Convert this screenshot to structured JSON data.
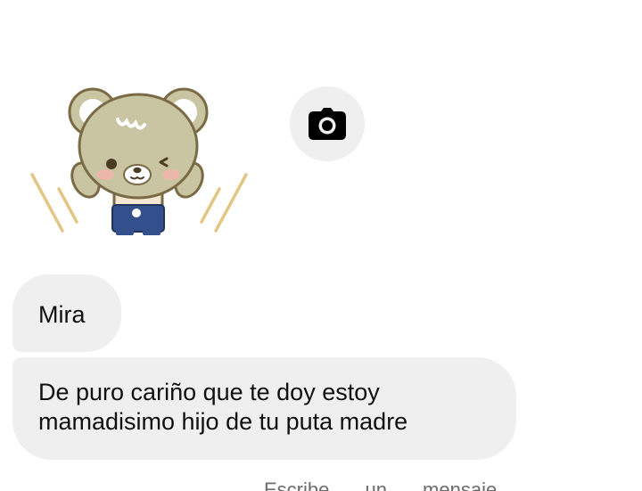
{
  "conversation": {
    "sticker_icon": "teddy-bear-sticker",
    "camera_icon": "camera-icon",
    "messages": [
      {
        "text": "Mira"
      },
      {
        "line1": "De puro cariño que te doy estoy",
        "line2": "mamadisimo hijo de tu puta madre"
      }
    ],
    "cutoff_text": "Escribe un mensaje"
  },
  "colors": {
    "bubble_bg": "#efefef",
    "camera_bg": "#efefef",
    "text": "#111111",
    "bear_fur": "#c9c5a2",
    "bear_outline": "#7a6a45"
  }
}
